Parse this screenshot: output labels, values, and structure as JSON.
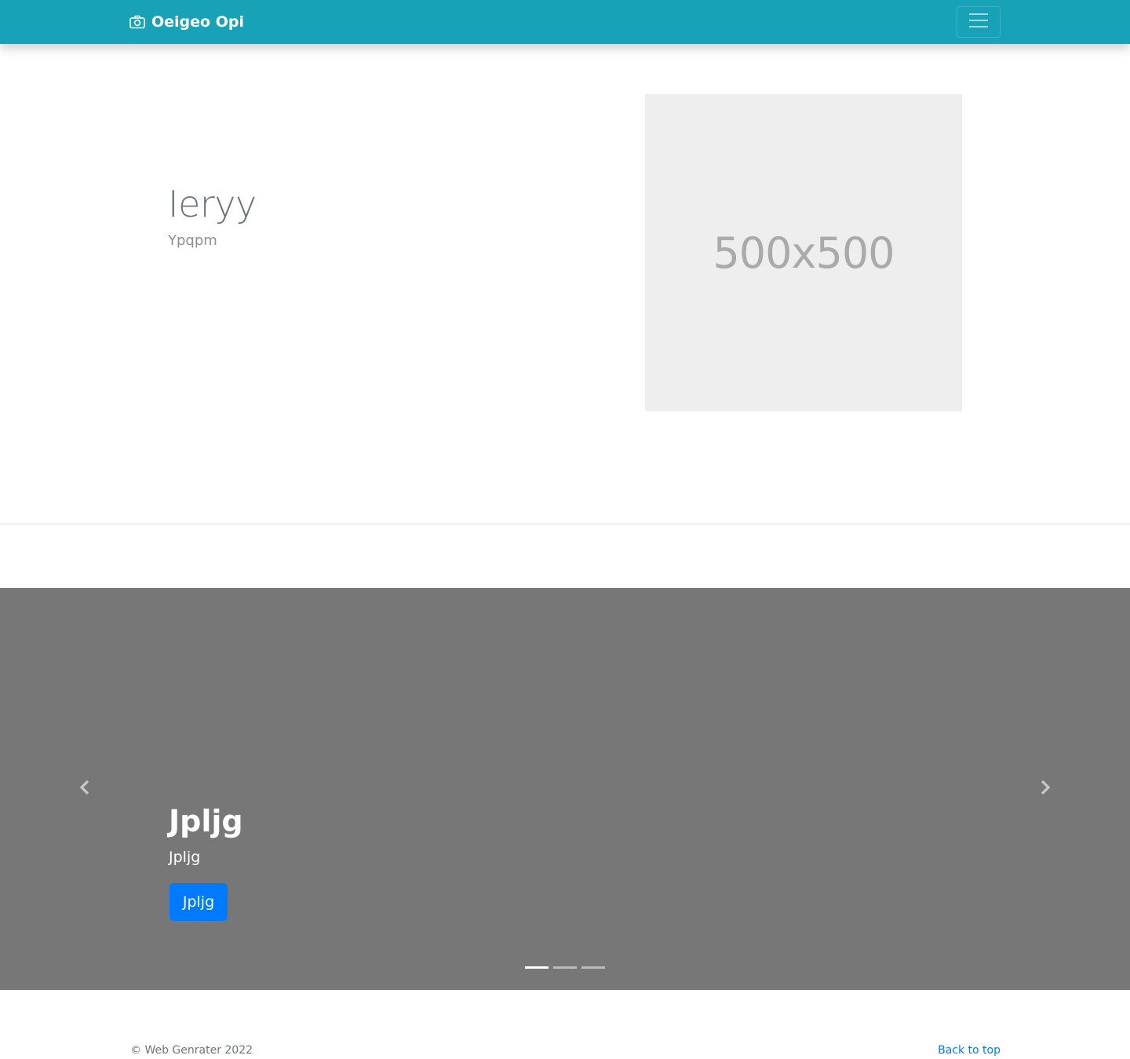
{
  "navbar": {
    "brand_text": "Oeigeo Opi",
    "brand_icon": "camera-icon",
    "toggler_icon": "hamburger-menu-icon",
    "background_color": "#17a2b8"
  },
  "hero": {
    "title": "Ieryy",
    "subtitle": "Ypqpm",
    "image_placeholder_text": "500x500"
  },
  "carousel": {
    "background_color": "#777777",
    "caption_title": "Jpljg",
    "caption_text": "Jpljg",
    "caption_button_label": "Jpljg",
    "indicators": [
      {
        "active": true
      },
      {
        "active": false
      },
      {
        "active": false
      }
    ],
    "prev_icon": "chevron-left-icon",
    "next_icon": "chevron-right-icon"
  },
  "footer": {
    "copyright": "© Web Genrater 2022",
    "back_to_top": "Back to top"
  },
  "colors": {
    "accent": "#17a2b8",
    "button_primary": "#007bff",
    "link": "#007bff"
  }
}
